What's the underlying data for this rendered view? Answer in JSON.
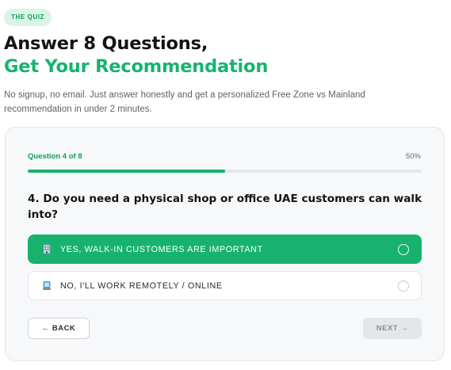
{
  "badge": "THE QUIZ",
  "headline": {
    "line1": "Answer 8 Questions,",
    "line2": "Get Your Recommendation"
  },
  "intro": "No signup, no email. Just answer honestly and get a personalized Free Zone vs Mainland recommendation in under 2 minutes.",
  "quiz": {
    "progress_label": "Question 4 of 8",
    "progress_percent_label": "50%",
    "progress_fraction": 0.5,
    "question": "4. Do you need a physical shop or office UAE customers can walk into?",
    "options": [
      {
        "label": "Yes, walk-in customers are important",
        "icon": "building-icon",
        "selected": true
      },
      {
        "label": "No, I'll work remotely / online",
        "icon": "laptop-icon",
        "selected": false
      }
    ],
    "back_label": "← BACK",
    "next_label": "NEXT →"
  },
  "colors": {
    "accent": "#17b36e",
    "badge_bg": "#d8f5e6"
  }
}
